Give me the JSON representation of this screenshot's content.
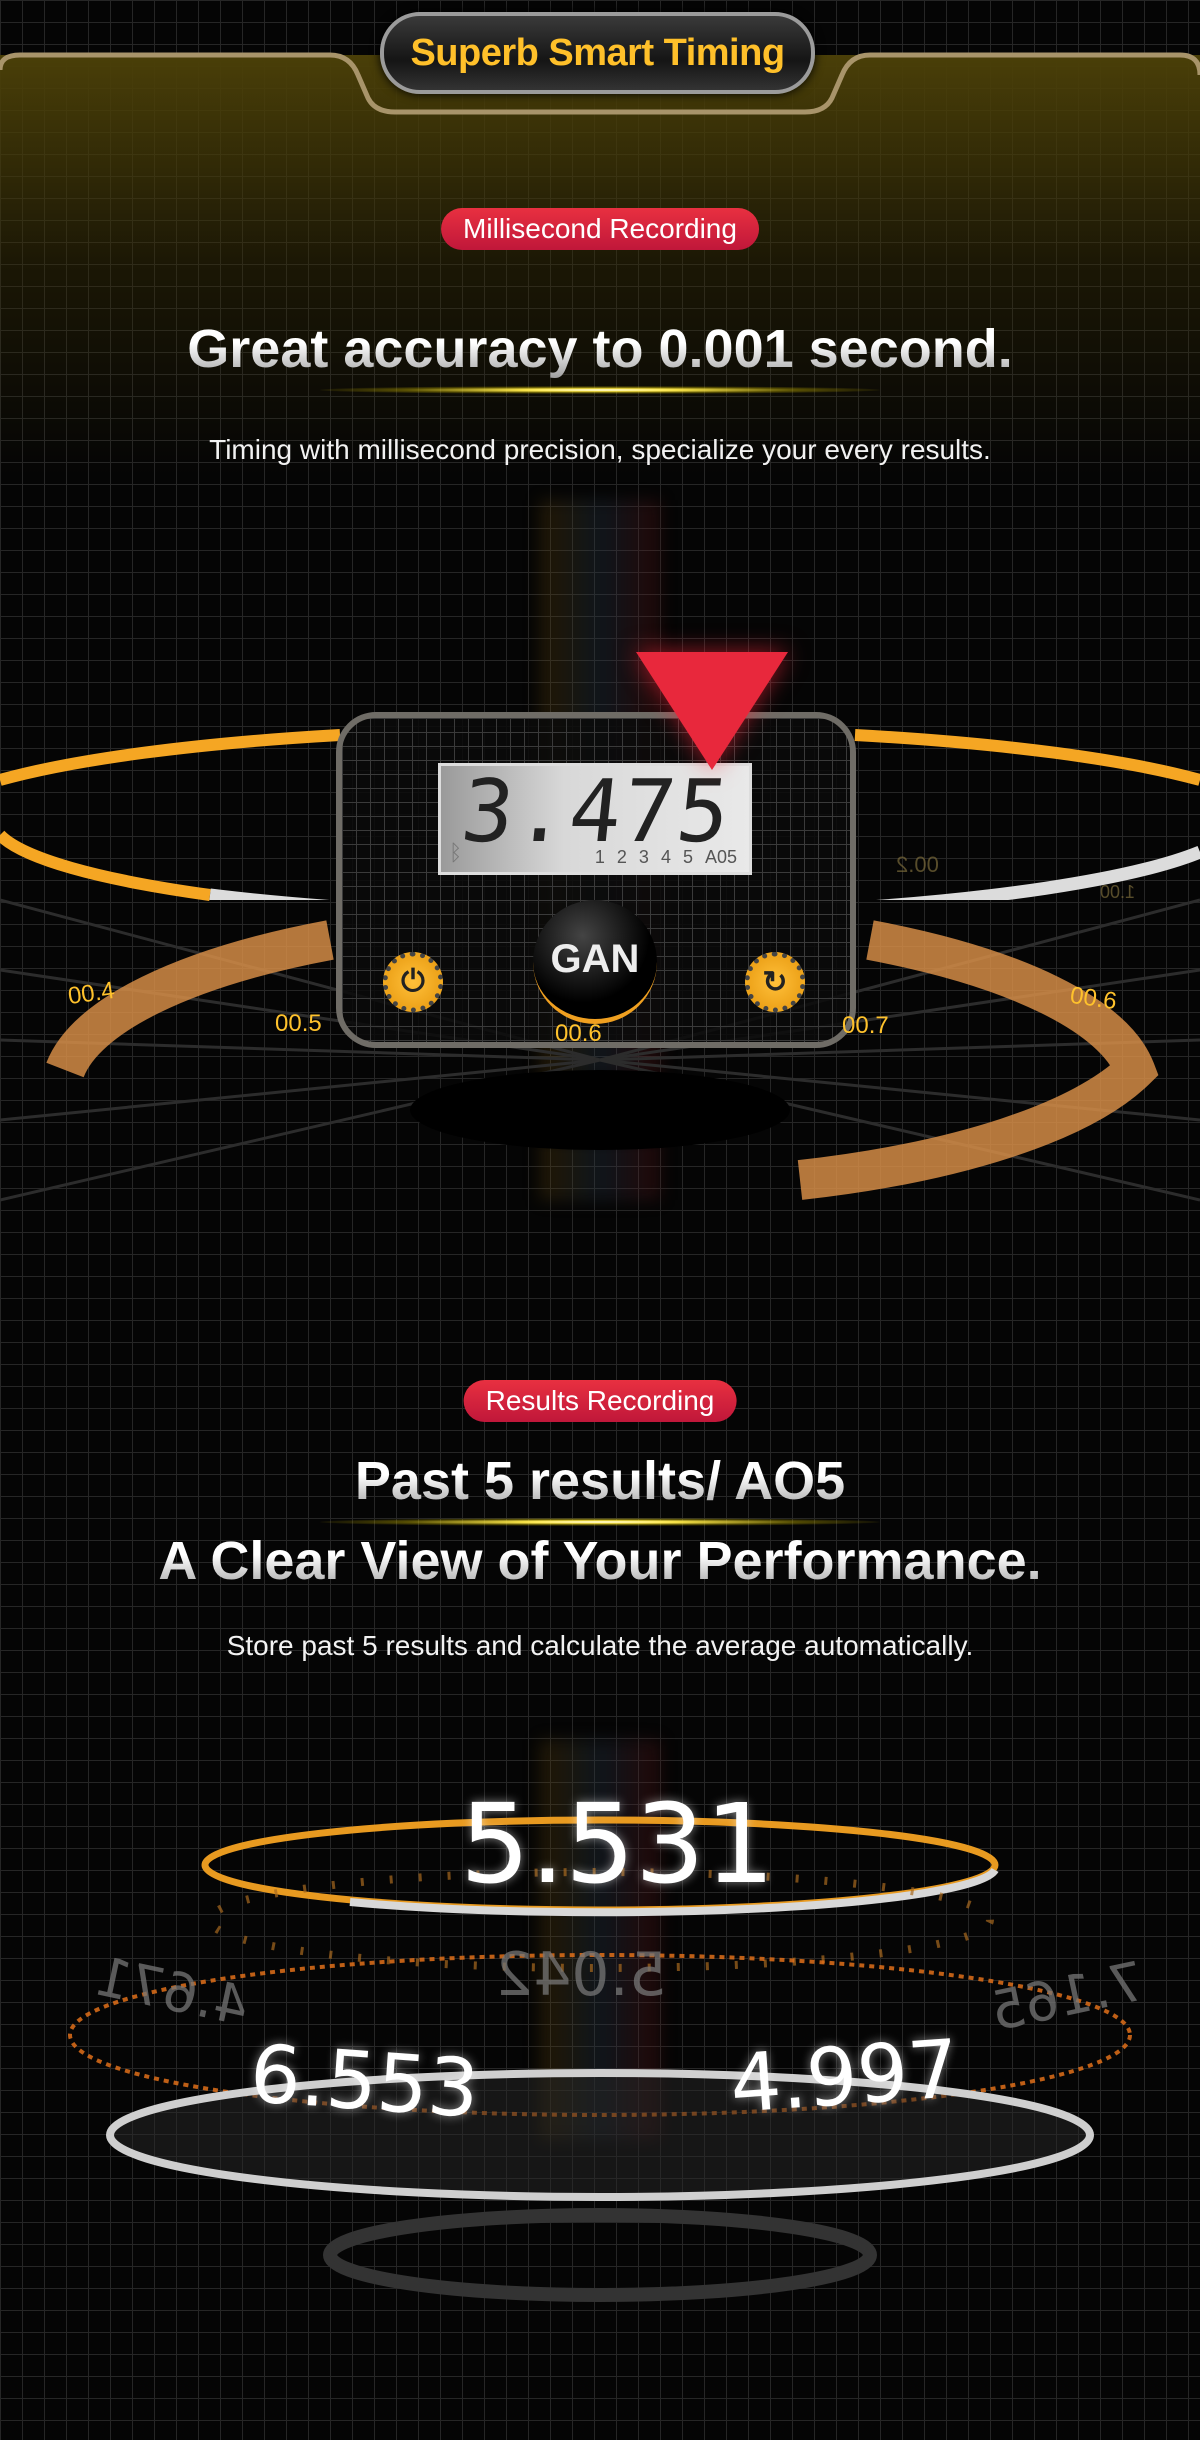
{
  "header": {
    "title": "Superb Smart Timing"
  },
  "section1": {
    "badge": "Millisecond Recording",
    "title": "Great accuracy to 0.001 second.",
    "subtitle": "Timing with millisecond precision, specialize your every results."
  },
  "timer": {
    "display": "3.475",
    "slots": [
      "1",
      "2",
      "3",
      "4",
      "5",
      "A05"
    ],
    "icons": {
      "bluetooth": "bluetooth-icon",
      "power": "power-icon",
      "reset": "refresh-icon",
      "logo": "gan-logo"
    },
    "scale_labels": [
      "00.4",
      "00.5",
      "00.6",
      "00.7",
      "00.6"
    ],
    "ghost_labels": [
      "00.2",
      "1.00"
    ]
  },
  "section2": {
    "badge": "Results Recording",
    "title_line1": "Past 5 results/ AO5",
    "title_line2": "A Clear View of Your Performance.",
    "subtitle": "Store past 5 results and calculate the average automatically."
  },
  "results": {
    "average": "5.531",
    "front_left": "6.553",
    "front_right": "4.997",
    "back_center": "5.042",
    "back_left": "4.671",
    "back_right": "7.165"
  },
  "colors": {
    "accent": "#f5a623",
    "badge": "#d6213d",
    "header_text": "#ffc02a"
  }
}
